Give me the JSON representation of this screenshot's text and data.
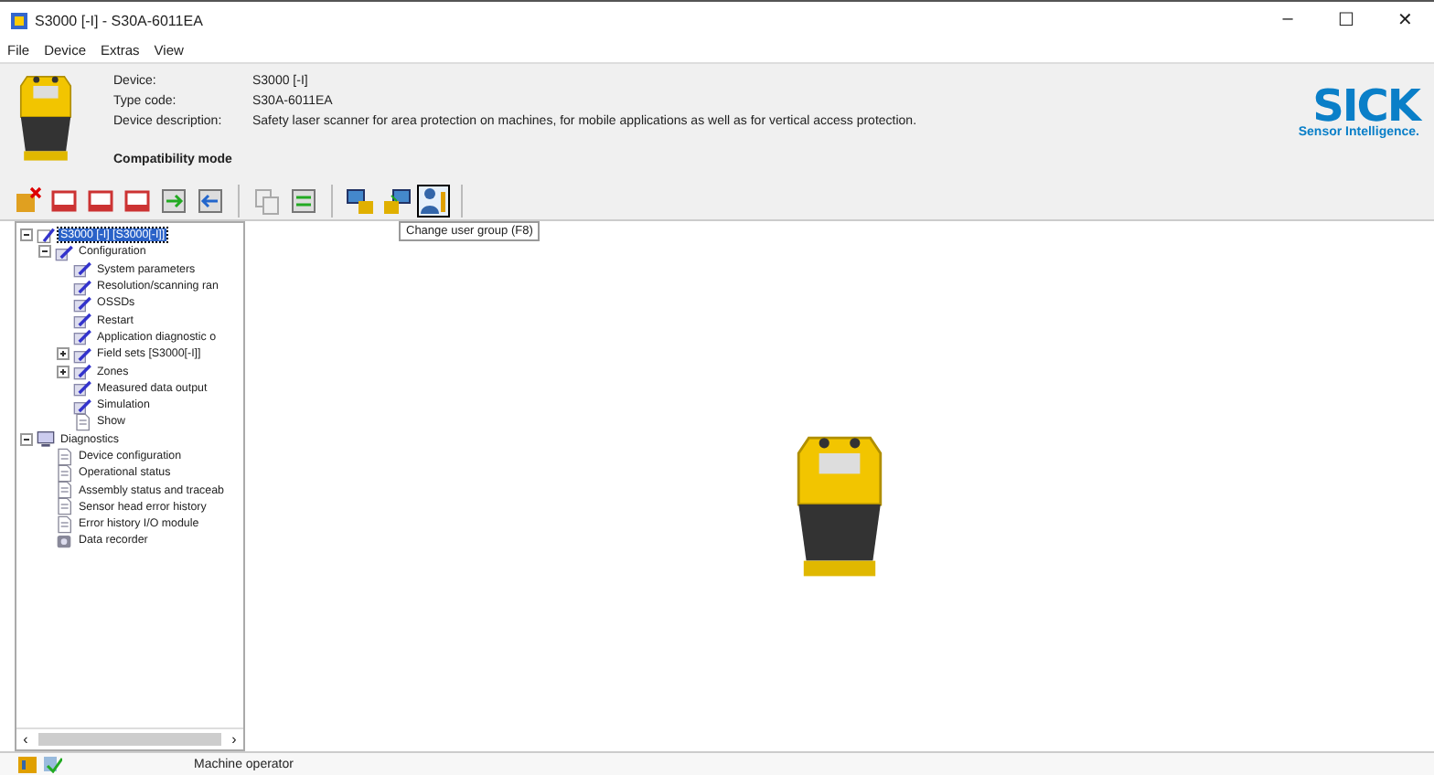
{
  "window": {
    "title": "S3000 [-I] - S30A-6011EA",
    "controls": [
      "–",
      "☐",
      "✕"
    ]
  },
  "menu": [
    "File",
    "Device",
    "Extras",
    "View"
  ],
  "header": {
    "fields": [
      {
        "label": "Device:",
        "value": "S3000 [-I]"
      },
      {
        "label": "Type code:",
        "value": "S30A-6011EA"
      },
      {
        "label": "Device description:",
        "value": "Safety laser scanner for area protection on machines, for mobile applications as well as for vertical access protection."
      }
    ],
    "mode": "Compatibility mode",
    "logo": "SICK",
    "tagline": "Sensor Intelligence."
  },
  "toolbar": {
    "groups": [
      [
        {
          "kind": "delete",
          "selected": false
        },
        {
          "kind": "frame",
          "selected": false
        },
        {
          "kind": "frame",
          "selected": false
        },
        {
          "kind": "frame",
          "selected": false
        },
        {
          "kind": "import",
          "selected": false
        },
        {
          "kind": "export",
          "selected": false
        }
      ],
      [
        {
          "kind": "copy",
          "selected": false
        },
        {
          "kind": "compare",
          "selected": false
        }
      ],
      [
        {
          "kind": "connect",
          "selected": false
        },
        {
          "kind": "disconnect",
          "selected": false
        },
        {
          "kind": "user",
          "selected": true
        }
      ]
    ],
    "tooltip": "Change user group (F8)"
  },
  "tree": [
    {
      "label": "S3000 [-I] [S3000[-I]]",
      "kind": "device",
      "selected": true,
      "expanded": true,
      "children": [
        {
          "label": "Configuration",
          "kind": "config",
          "selected": false,
          "expanded": true,
          "children": [
            {
              "label": "System parameters",
              "kind": "config",
              "selected": false
            },
            {
              "label": "Resolution/scanning ran",
              "kind": "config",
              "selected": false
            },
            {
              "label": "OSSDs",
              "kind": "config",
              "selected": false
            },
            {
              "label": "Restart",
              "kind": "config",
              "selected": false
            },
            {
              "label": "Application diagnostic o",
              "kind": "config",
              "selected": false
            },
            {
              "label": "Field sets [S3000[-I]]",
              "kind": "config",
              "selected": false,
              "expanded": false
            },
            {
              "label": "Zones",
              "kind": "config",
              "selected": false,
              "expanded": false
            },
            {
              "label": "Measured data output",
              "kind": "config",
              "selected": false
            },
            {
              "label": "Simulation",
              "kind": "config",
              "selected": false
            },
            {
              "label": "Show",
              "kind": "page",
              "selected": false
            }
          ]
        }
      ]
    },
    {
      "label": "Diagnostics",
      "kind": "diag",
      "selected": false,
      "expanded": true,
      "children": [
        {
          "label": "Device configuration",
          "kind": "page",
          "selected": false
        },
        {
          "label": "Operational status",
          "kind": "page",
          "selected": false
        },
        {
          "label": "Assembly status and traceab",
          "kind": "page",
          "selected": false
        },
        {
          "label": "Sensor head error history",
          "kind": "page",
          "selected": false
        },
        {
          "label": "Error history I/O module",
          "kind": "page",
          "selected": false
        },
        {
          "label": "Data recorder",
          "kind": "recorder",
          "selected": false
        }
      ]
    }
  ],
  "tree_scroll": {
    "left": "‹",
    "right": "›"
  },
  "status_bar": {
    "user": "Machine operator"
  }
}
